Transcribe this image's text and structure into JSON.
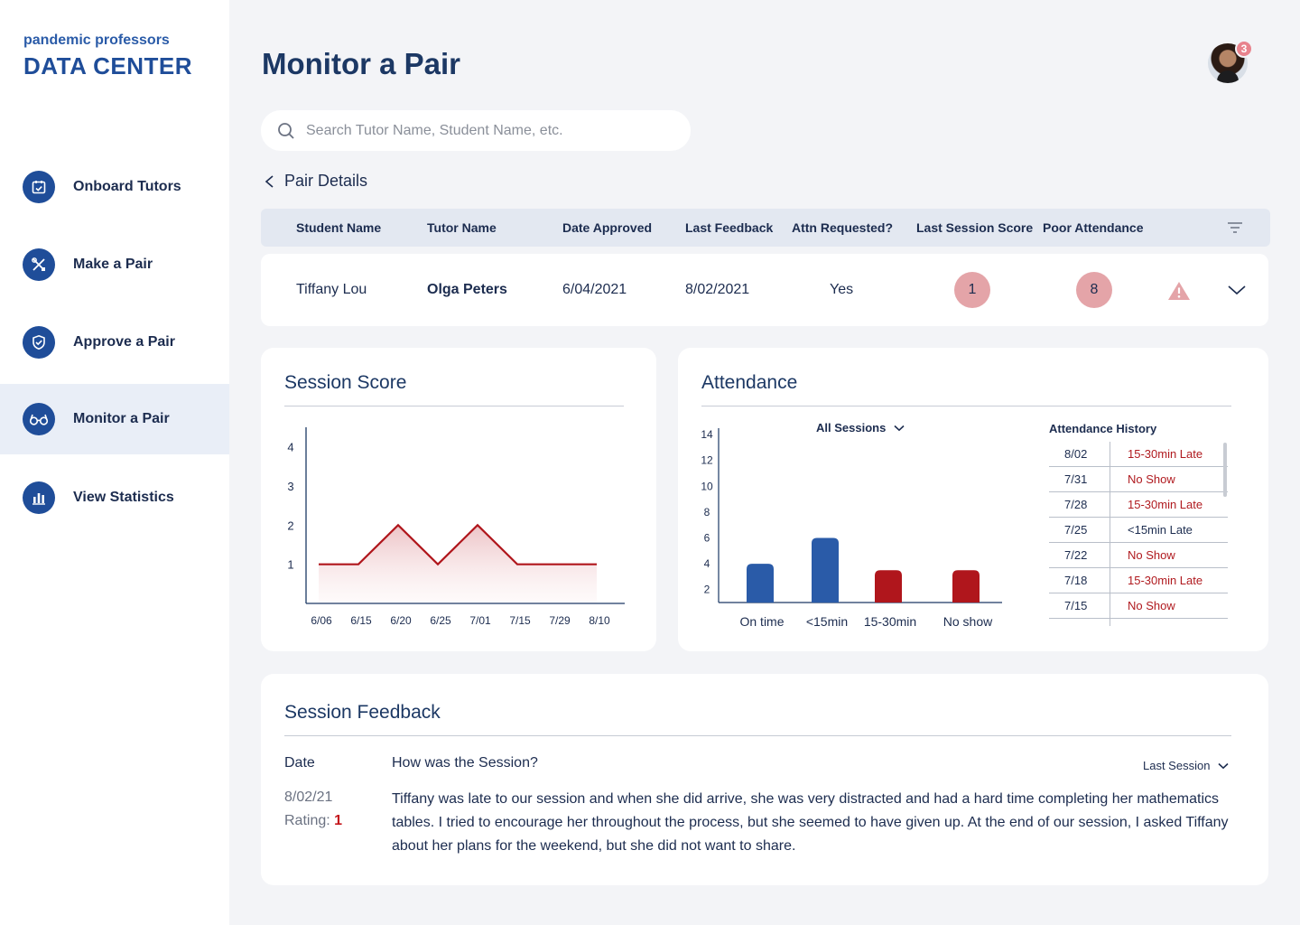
{
  "brand": {
    "top": "pandemic professors",
    "main": "DATA CENTER"
  },
  "nav": [
    {
      "label": "Onboard Tutors",
      "icon": "calendar-check-icon"
    },
    {
      "label": "Make a Pair",
      "icon": "tools-icon"
    },
    {
      "label": "Approve a Pair",
      "icon": "shield-check-icon"
    },
    {
      "label": "Monitor a Pair",
      "icon": "glasses-icon",
      "active": true
    },
    {
      "label": "View Statistics",
      "icon": "bar-chart-icon"
    }
  ],
  "header": {
    "title": "Monitor a Pair",
    "notifications": "3"
  },
  "search": {
    "placeholder": "Search Tutor Name, Student Name, etc."
  },
  "pair": {
    "back_label": "Pair Details",
    "columns": [
      "Student Name",
      "Tutor Name",
      "Date Approved",
      "Last Feedback",
      "Attn Requested?",
      "Last Session Score",
      "Poor Attendance"
    ],
    "row": {
      "student": "Tiffany Lou",
      "tutor": "Olga Peters",
      "date_approved": "6/04/2021",
      "last_feedback": "8/02/2021",
      "attn_requested": "Yes",
      "last_session_score": "1",
      "poor_attendance": "8"
    }
  },
  "session_score": {
    "title": "Session Score"
  },
  "attendance": {
    "title": "Attendance",
    "filter": "All Sessions",
    "history_title": "Attendance History",
    "history": [
      {
        "date": "8/02",
        "status": "15-30min Late",
        "bad": true
      },
      {
        "date": "7/31",
        "status": "No Show",
        "bad": true
      },
      {
        "date": "7/28",
        "status": "15-30min Late",
        "bad": true
      },
      {
        "date": "7/25",
        "status": "<15min Late",
        "bad": false
      },
      {
        "date": "7/22",
        "status": "No Show",
        "bad": true
      },
      {
        "date": "7/18",
        "status": "15-30min Late",
        "bad": true
      },
      {
        "date": "7/15",
        "status": "No Show",
        "bad": true
      }
    ]
  },
  "feedback": {
    "title": "Session Feedback",
    "date_header": "Date",
    "question_header": "How was the Session?",
    "period": "Last Session",
    "date": "8/02/21",
    "rating_label": "Rating:",
    "rating": "1",
    "text": "Tiffany was late to our session and when she did arrive, she was very distracted and had a hard time completing her mathematics tables. I tried to encourage her throughout the process, but she seemed to have given up. At the end of our session, I asked Tiffany about her plans for the weekend, but she did not want to share."
  },
  "colors": {
    "primary": "#1f4d99",
    "alert": "#b01a1f",
    "badge": "#e4a4a8",
    "blue_bar": "#2a5ba8",
    "red_bar": "#b0161c"
  },
  "chart_data": [
    {
      "type": "line",
      "x": [
        "6/06",
        "6/15",
        "6/20",
        "6/25",
        "7/01",
        "7/15",
        "7/29",
        "8/10"
      ],
      "series": [
        {
          "values": [
            1,
            1,
            2,
            1,
            2,
            1,
            1,
            1
          ]
        }
      ],
      "yticks": [
        1,
        2,
        3,
        4
      ],
      "ylim": [
        0,
        4.5
      ]
    },
    {
      "type": "bar",
      "categories": [
        "On time",
        "<15min",
        "15-30min",
        "No show"
      ],
      "values": [
        4,
        6,
        3.5,
        3.5
      ],
      "yticks": [
        2,
        4,
        6,
        8,
        10,
        12,
        14
      ],
      "ylim": [
        1,
        14.5
      ]
    }
  ]
}
